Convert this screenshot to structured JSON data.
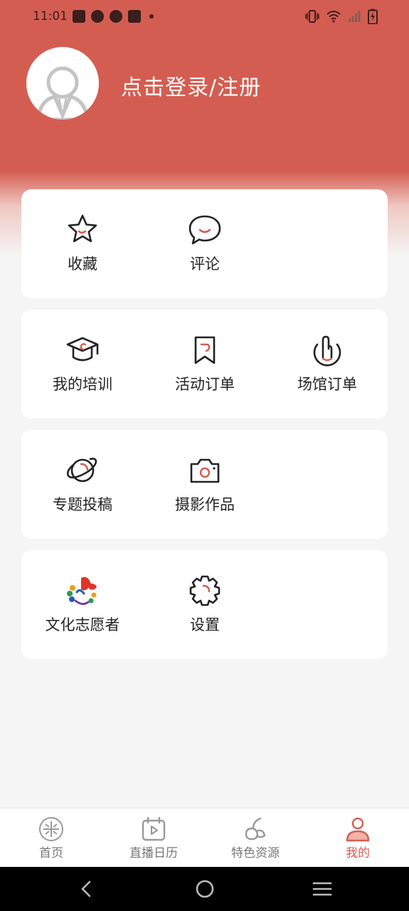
{
  "status_bar": {
    "time": "11:01",
    "icons_left": [
      "shopping-bag-icon",
      "speedometer-icon",
      "speedometer-icon",
      "shopping-bag-icon",
      "dot-icon"
    ],
    "icons_right": [
      "vibrate-icon",
      "wifi-icon",
      "signal-icon",
      "battery-charging-icon"
    ]
  },
  "header": {
    "login_text": "点击登录/注册",
    "background_color": "#d45d51"
  },
  "cards": [
    {
      "items": [
        {
          "label": "收藏",
          "icon": "star-icon"
        },
        {
          "label": "评论",
          "icon": "comment-icon"
        }
      ]
    },
    {
      "items": [
        {
          "label": "我的培训",
          "icon": "graduation-cap-icon"
        },
        {
          "label": "活动订单",
          "icon": "bookmark-icon"
        },
        {
          "label": "场馆订单",
          "icon": "touch-icon"
        }
      ]
    },
    {
      "items": [
        {
          "label": "专题投稿",
          "icon": "planet-icon"
        },
        {
          "label": "摄影作品",
          "icon": "camera-icon"
        }
      ]
    },
    {
      "items": [
        {
          "label": "文化志愿者",
          "icon": "volunteer-logo-icon"
        },
        {
          "label": "设置",
          "icon": "settings-gear-icon"
        }
      ]
    }
  ],
  "tabbar": {
    "tabs": [
      {
        "label": "首页",
        "icon": "home-logo-icon"
      },
      {
        "label": "直播日历",
        "icon": "live-calendar-icon"
      },
      {
        "label": "特色资源",
        "icon": "resource-icon"
      },
      {
        "label": "我的",
        "icon": "profile-icon",
        "active": true
      }
    ],
    "active_color": "#d45d51"
  },
  "system_nav": {
    "buttons": [
      "back-icon",
      "home-icon",
      "recents-icon"
    ]
  }
}
